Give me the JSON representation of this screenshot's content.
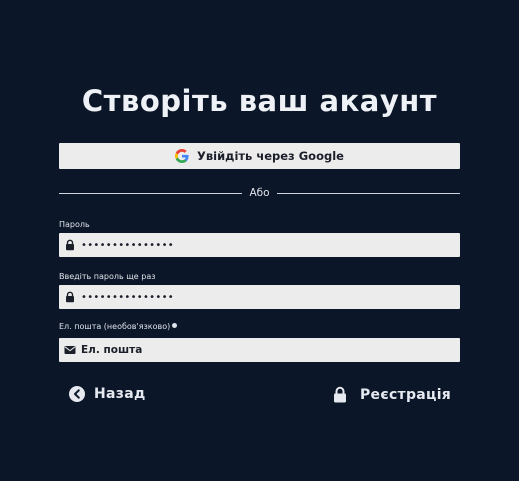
{
  "page": {
    "title": "Створіть ваш акаунт"
  },
  "google": {
    "label": "Увійдіть через Google",
    "icon": "google-g-icon"
  },
  "divider": {
    "text": "Або"
  },
  "password": {
    "label": "Пароль",
    "value": "•••••••••••••••",
    "icon": "lock-icon"
  },
  "password_repeat": {
    "label": "Введіть пароль ще раз",
    "value": "•••••••••••••••",
    "icon": "lock-icon"
  },
  "email": {
    "label": "Ел. пошта (необов'язково)",
    "placeholder": "Ел. пошта",
    "icon": "envelope-icon"
  },
  "actions": {
    "back_label": "Назад",
    "back_icon": "arrow-left-circle-icon",
    "register_label": "Реєстрація",
    "register_icon": "lock-icon"
  },
  "colors": {
    "background": "#0b1628",
    "field": "#ececec",
    "text": "#e6e9ef"
  }
}
